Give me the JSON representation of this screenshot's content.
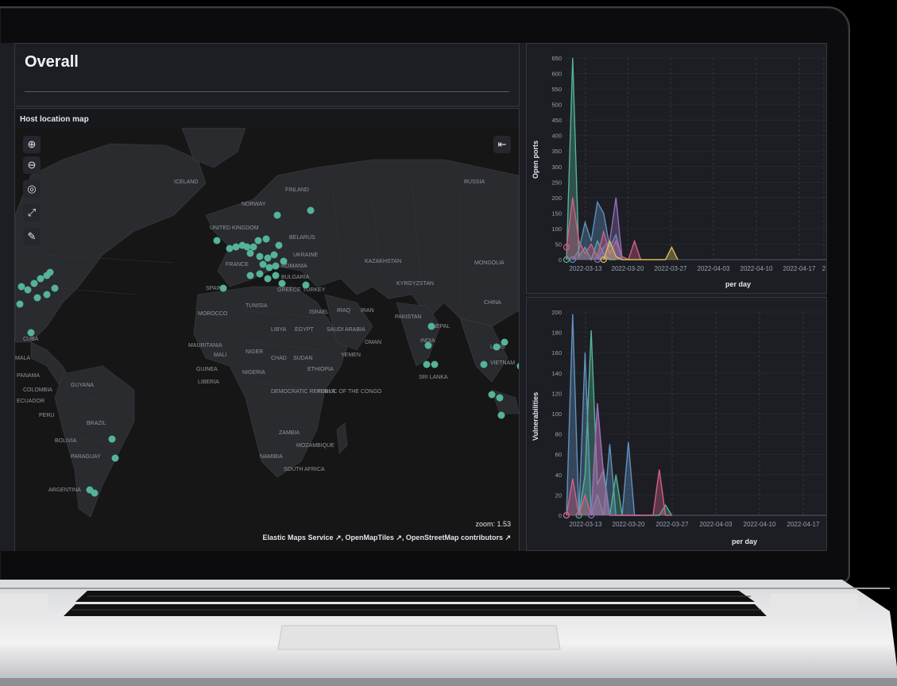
{
  "overall": {
    "title": "Overall"
  },
  "map": {
    "title": "Host location map",
    "zoom_label": "zoom:",
    "zoom_value": "1.53",
    "attribution": "Elastic Maps Service ↗, OpenMapTiles ↗, OpenStreetMap contributors ↗",
    "controls": [
      "zoom-in-icon",
      "zoom-out-icon",
      "locate-icon",
      "expand-icon",
      "tools-icon"
    ],
    "country_labels": [
      "ICELAND",
      "FINLAND",
      "NORWAY",
      "RUSSIA",
      "UNITED KINGDOM",
      "BELARUS",
      "UKRAINE",
      "FRANCE",
      "ROMANIA",
      "KAZAKHSTAN",
      "MONGOLIA",
      "BULGARIA",
      "KYRGYZSTAN",
      "SPAIN",
      "GREECE",
      "TURKEY",
      "TUNISIA",
      "MOROCCO",
      "ISRAEL",
      "IRAQ",
      "IRAN",
      "PAKISTAN",
      "CHINA",
      "LIBYA",
      "EGYPT",
      "SAUDI ARABIA",
      "NEPAL",
      "INDIA",
      "OMAN",
      "MAURITANIA",
      "MALI",
      "NIGER",
      "CHAD",
      "SUDAN",
      "YEMEN",
      "GUINEA",
      "NIGERIA",
      "ETHIOPIA",
      "LIBERIA",
      "LAOS",
      "VIETNAM",
      "SRI LANKA",
      "CUBA",
      "MALA",
      "PANAMA",
      "GUYANA",
      "COLOMBIA",
      "ECUADOR",
      "PERU",
      "BRAZIL",
      "BOLIVIA",
      "PARAGUAY",
      "ARGENTINA",
      "DEMOCRATIC REPUBLIC OF THE CONGO",
      "KENYA",
      "ZAMBIA",
      "MOZAMBIQUE",
      "NAMIBIA",
      "SOUTH AFRICA"
    ],
    "point_color": "#54b399"
  },
  "chart_data": [
    {
      "type": "area",
      "title": "",
      "ylabel": "Open ports",
      "xlabel": "per day",
      "ylim": [
        0,
        650
      ],
      "yticks": [
        0,
        50,
        100,
        150,
        200,
        250,
        300,
        350,
        400,
        450,
        500,
        550,
        600,
        650
      ],
      "xticks": [
        "2022-03-13",
        "2022-03-20",
        "2022-03-27",
        "2022-04-03",
        "2022-04-10",
        "2022-04-17",
        "2"
      ],
      "series": [
        {
          "color": "#54b399",
          "x": [
            "2022-03-09",
            "2022-03-10",
            "2022-03-11",
            "2022-03-12",
            "2022-03-13",
            "2022-03-14",
            "2022-03-15",
            "2022-03-16",
            "2022-03-17"
          ],
          "values": [
            0,
            650,
            10,
            40,
            0,
            60,
            20,
            0,
            0
          ]
        },
        {
          "color": "#6092c0",
          "x": [
            "2022-03-10",
            "2022-03-11",
            "2022-03-12",
            "2022-03-13",
            "2022-03-14",
            "2022-03-15",
            "2022-03-16",
            "2022-03-17",
            "2022-03-18"
          ],
          "values": [
            0,
            30,
            120,
            60,
            185,
            150,
            40,
            80,
            0
          ]
        },
        {
          "color": "#d36086",
          "x": [
            "2022-03-09",
            "2022-03-10",
            "2022-03-11",
            "2022-03-12",
            "2022-03-13",
            "2022-03-14",
            "2022-03-15",
            "2022-03-16",
            "2022-03-17",
            "2022-03-18",
            "2022-03-19",
            "2022-03-20",
            "2022-03-21"
          ],
          "values": [
            40,
            200,
            60,
            20,
            50,
            10,
            90,
            20,
            60,
            10,
            0,
            60,
            0
          ]
        },
        {
          "color": "#9170b8",
          "x": [
            "2022-03-14",
            "2022-03-15",
            "2022-03-16",
            "2022-03-17",
            "2022-03-18"
          ],
          "values": [
            0,
            40,
            60,
            200,
            0
          ]
        },
        {
          "color": "#d6bf57",
          "x": [
            "2022-03-15",
            "2022-03-16",
            "2022-03-17",
            "2022-03-18",
            "2022-03-25",
            "2022-03-26",
            "2022-03-27"
          ],
          "values": [
            0,
            60,
            10,
            0,
            0,
            40,
            0
          ]
        }
      ]
    },
    {
      "type": "area",
      "title": "",
      "ylabel": "Vulnerabilities",
      "xlabel": "per day",
      "ylim": [
        0,
        200
      ],
      "yticks": [
        0,
        20,
        40,
        60,
        80,
        100,
        120,
        140,
        160,
        180,
        200
      ],
      "xticks": [
        "2022-03-13",
        "2022-03-20",
        "2022-03-27",
        "2022-04-03",
        "2022-04-10",
        "2022-04-17"
      ],
      "series": [
        {
          "color": "#6092c0",
          "x": [
            "2022-03-09",
            "2022-03-10",
            "2022-03-11",
            "2022-03-12",
            "2022-03-13",
            "2022-03-14",
            "2022-03-15",
            "2022-03-16",
            "2022-03-17",
            "2022-03-18",
            "2022-03-19",
            "2022-03-20",
            "2022-03-21"
          ],
          "values": [
            0,
            198,
            0,
            160,
            0,
            20,
            0,
            70,
            0,
            0,
            72,
            0,
            0
          ]
        },
        {
          "color": "#54b399",
          "x": [
            "2022-03-11",
            "2022-03-12",
            "2022-03-13",
            "2022-03-14",
            "2022-03-15",
            "2022-03-16",
            "2022-03-17",
            "2022-03-18",
            "2022-03-24",
            "2022-03-25",
            "2022-03-26"
          ],
          "values": [
            0,
            40,
            182,
            30,
            45,
            0,
            40,
            0,
            0,
            10,
            0
          ]
        },
        {
          "color": "#d36086",
          "x": [
            "2022-03-09",
            "2022-03-10",
            "2022-03-11",
            "2022-03-12",
            "2022-03-13",
            "2022-03-14",
            "2022-03-15",
            "2022-03-16",
            "2022-03-21",
            "2022-03-22",
            "2022-03-23",
            "2022-03-24",
            "2022-03-25",
            "2022-03-26"
          ],
          "values": [
            0,
            36,
            0,
            20,
            0,
            110,
            40,
            0,
            0,
            0,
            0,
            45,
            0,
            0
          ]
        },
        {
          "color": "#9170b8",
          "x": [
            "2022-03-13",
            "2022-03-14",
            "2022-03-15",
            "2022-03-16"
          ],
          "values": [
            0,
            110,
            40,
            0
          ]
        }
      ]
    }
  ]
}
